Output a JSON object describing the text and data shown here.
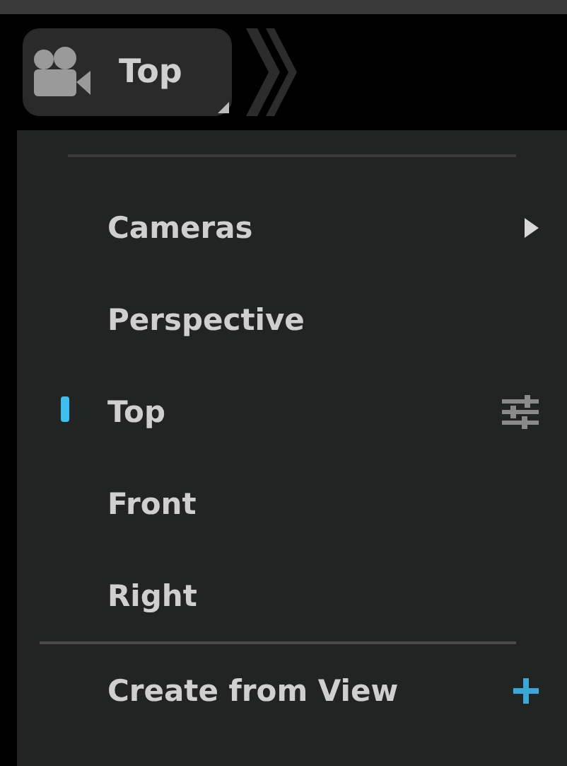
{
  "header": {
    "label": "Top"
  },
  "menu": [
    {
      "kind": "divider"
    },
    {
      "kind": "submenu",
      "label": "Cameras"
    },
    {
      "kind": "option",
      "label": "Perspective",
      "selected": false
    },
    {
      "kind": "option",
      "label": "Top",
      "selected": true
    },
    {
      "kind": "option",
      "label": "Front",
      "selected": false
    },
    {
      "kind": "option",
      "label": "Right",
      "selected": false
    },
    {
      "kind": "divider"
    },
    {
      "kind": "action",
      "label": "Create from View"
    }
  ]
}
